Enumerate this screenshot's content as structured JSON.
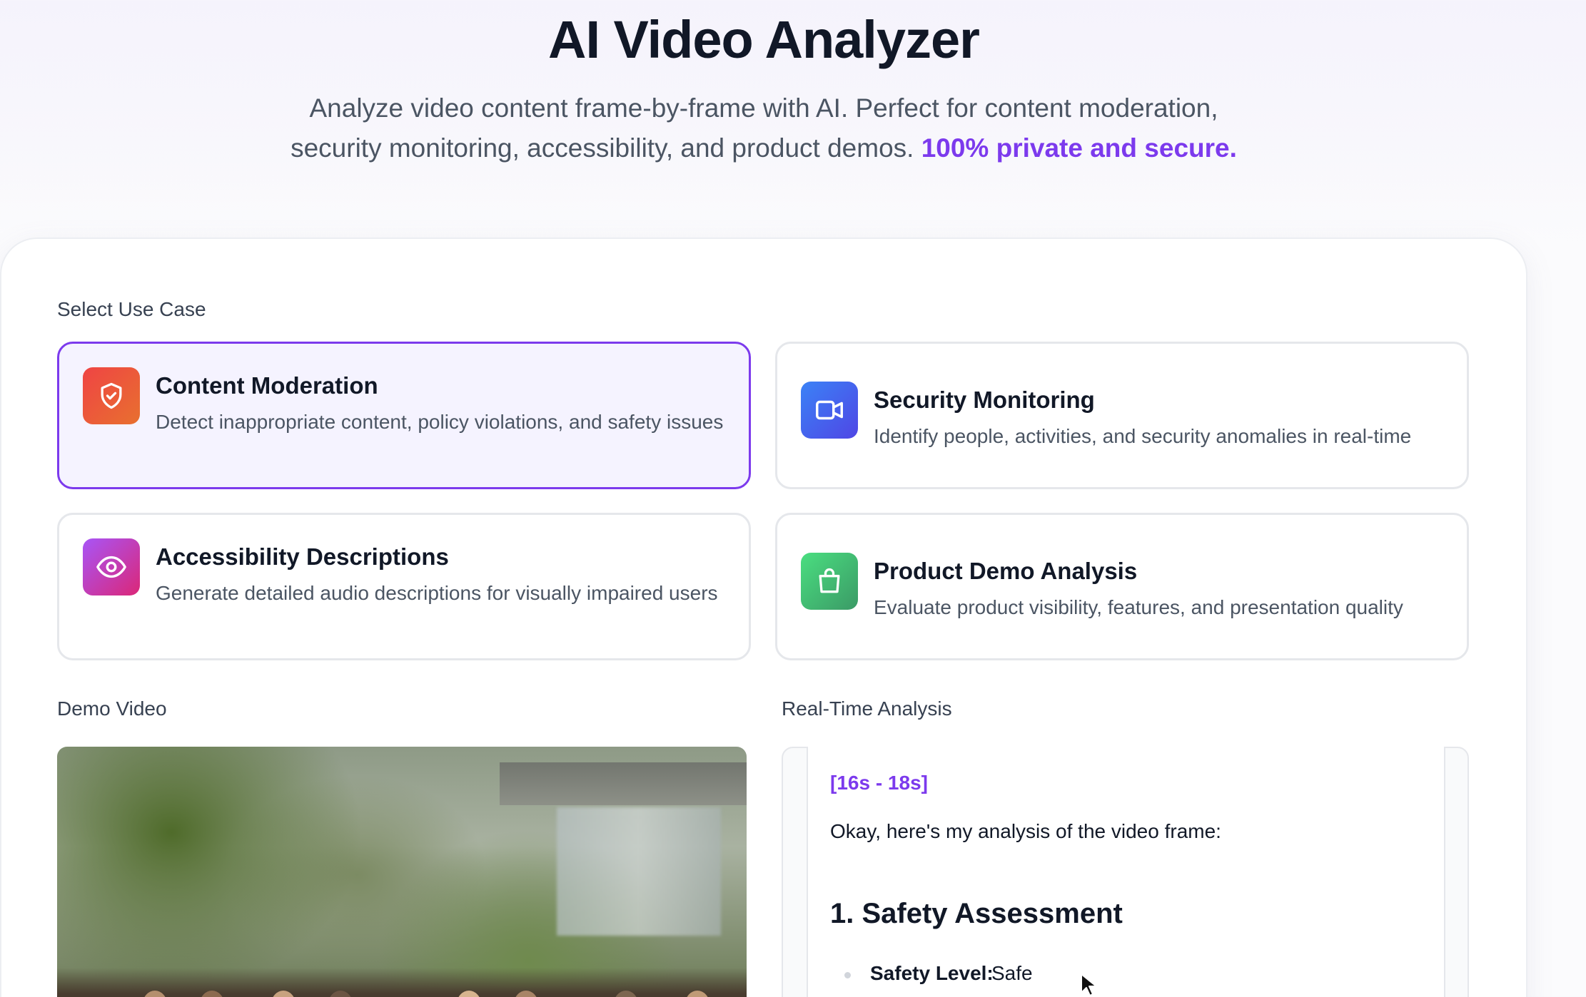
{
  "hero": {
    "title": "AI Video Analyzer",
    "subtitle_line1": "Analyze video content frame-by-frame with AI. Perfect for content moderation,",
    "subtitle_line2": "security monitoring, accessibility, and product demos.",
    "subtitle_highlight": "100% private and secure."
  },
  "use_case": {
    "label": "Select Use Case",
    "cards": [
      {
        "title": "Content Moderation",
        "description": "Detect inappropriate content, policy violations, and safety issues",
        "icon": "shield-check-icon",
        "selected": true
      },
      {
        "title": "Security Monitoring",
        "description": "Identify people, activities, and security anomalies in real-time",
        "icon": "video-camera-icon",
        "selected": false
      },
      {
        "title": "Accessibility Descriptions",
        "description": "Generate detailed audio descriptions for visually impaired users",
        "icon": "eye-icon",
        "selected": false
      },
      {
        "title": "Product Demo Analysis",
        "description": "Evaluate product visibility, features, and presentation quality",
        "icon": "shopping-bag-icon",
        "selected": false
      }
    ]
  },
  "demo_video": {
    "label": "Demo Video"
  },
  "analysis": {
    "label": "Real-Time Analysis",
    "timestamp": "[16s - 18s]",
    "intro": "Okay, here's my analysis of the video frame:",
    "heading": "1. Safety Assessment",
    "bullet_key": "Safety Level:",
    "bullet_value": "Safe"
  },
  "colors": {
    "accent": "#7c3aed",
    "card_selected_bg": "#f5f3ff",
    "moderation_icon": "#e9553a",
    "security_icon": "#4f46e5",
    "accessibility_icon": "#c03ea8",
    "product_icon": "#3fa66a"
  }
}
